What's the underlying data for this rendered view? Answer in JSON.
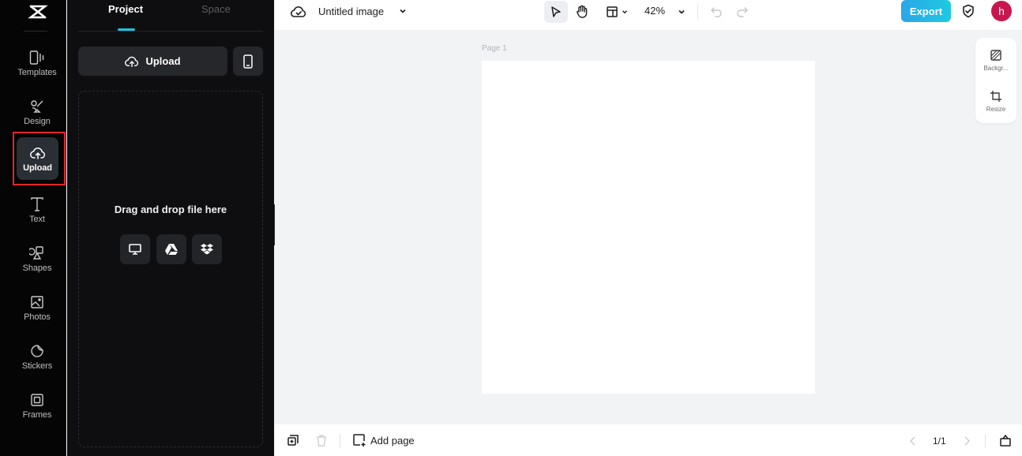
{
  "nav": {
    "items": [
      {
        "label": "Templates",
        "icon": "templates-icon"
      },
      {
        "label": "Design",
        "icon": "design-icon"
      },
      {
        "label": "Upload",
        "icon": "upload-cloud-icon",
        "active": true
      },
      {
        "label": "Text",
        "icon": "text-icon"
      },
      {
        "label": "Shapes",
        "icon": "shapes-icon"
      },
      {
        "label": "Photos",
        "icon": "photos-icon"
      },
      {
        "label": "Stickers",
        "icon": "stickers-icon"
      },
      {
        "label": "Frames",
        "icon": "frames-icon"
      }
    ]
  },
  "panel": {
    "tabs": [
      {
        "label": "Project",
        "active": true
      },
      {
        "label": "Space",
        "active": false
      }
    ],
    "upload_label": "Upload",
    "drop_text": "Drag and drop file here",
    "sources": [
      "computer-icon",
      "google-drive-icon",
      "dropbox-icon"
    ]
  },
  "topbar": {
    "title": "Untitled image",
    "zoom": "42%",
    "export_label": "Export",
    "avatar_initial": "h"
  },
  "canvas": {
    "page_label": "Page 1",
    "right_tools": [
      {
        "label": "Backgr...",
        "icon": "background-icon"
      },
      {
        "label": "Resize",
        "icon": "resize-icon"
      }
    ]
  },
  "bottombar": {
    "add_page_label": "Add page",
    "page_count": "1/1"
  },
  "colors": {
    "accent": "#1fc2de",
    "export_gradient_start": "#2aa6e9",
    "export_gradient_end": "#1ecae0",
    "avatar": "#c8174e",
    "highlight": "#e5252a"
  }
}
